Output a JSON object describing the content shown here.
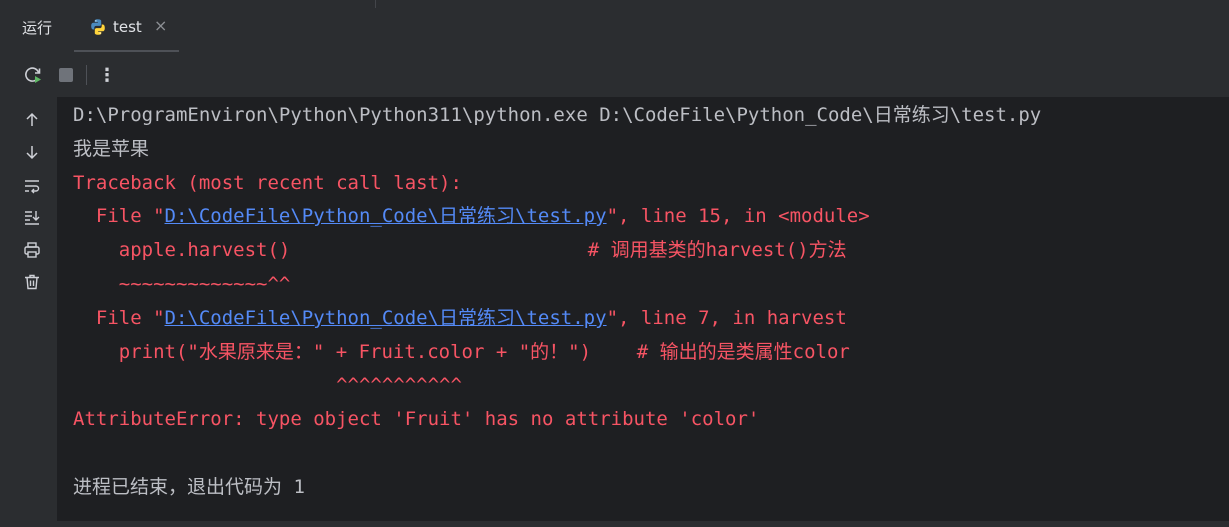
{
  "tool_window": {
    "title": "运行"
  },
  "tab": {
    "label": "test",
    "close": "×"
  },
  "toolbar": {
    "more": "⋮"
  },
  "console": {
    "command": "D:\\ProgramEnviron\\Python\\Python311\\python.exe D:\\CodeFile\\Python_Code\\日常练习\\test.py",
    "output1": "我是苹果",
    "traceback_header": "Traceback (most recent call last):",
    "frame1": {
      "prefix": "  File \"",
      "path": "D:\\CodeFile\\Python_Code\\日常练习\\test.py",
      "suffix": "\", line 15, in <module>",
      "code": "    apple.harvest()                          # 调用基类的harvest()方法",
      "marker": "    ~~~~~~~~~~~~~^^"
    },
    "frame2": {
      "prefix": "  File \"",
      "path": "D:\\CodeFile\\Python_Code\\日常练习\\test.py",
      "suffix": "\", line 7, in harvest",
      "code": "    print(\"水果原来是：\" + Fruit.color + \"的！\")    # 输出的是类属性color",
      "marker": "                       ^^^^^^^^^^^"
    },
    "error": "AttributeError: type object 'Fruit' has no attribute 'color'",
    "exit_message": "进程已结束，退出代码为 1"
  },
  "colors": {
    "background": "#1e1f22",
    "panel": "#2b2d30",
    "normal_text": "#bcbec4",
    "error_text": "#f75464",
    "link": "#548af7"
  }
}
